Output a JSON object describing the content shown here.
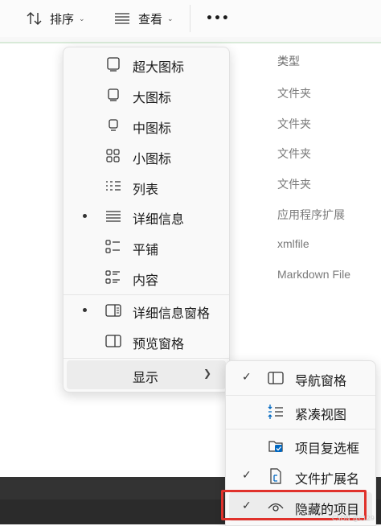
{
  "toolbar": {
    "sort_label": "排序",
    "view_label": "查看",
    "more_label": "•••"
  },
  "file_list": {
    "type_header": "类型",
    "types": [
      "文件夹",
      "文件夹",
      "文件夹",
      "文件夹",
      "应用程序扩展",
      "xmlfile",
      "Markdown File"
    ]
  },
  "view_menu": {
    "items": [
      {
        "label": "超大图标",
        "icon": "extra-large-icons-icon",
        "selected": false
      },
      {
        "label": "大图标",
        "icon": "large-icons-icon",
        "selected": false
      },
      {
        "label": "中图标",
        "icon": "medium-icons-icon",
        "selected": false
      },
      {
        "label": "小图标",
        "icon": "small-icons-icon",
        "selected": false
      },
      {
        "label": "列表",
        "icon": "list-icon",
        "selected": false
      },
      {
        "label": "详细信息",
        "icon": "details-icon",
        "selected": true
      },
      {
        "label": "平铺",
        "icon": "tiles-icon",
        "selected": false
      },
      {
        "label": "内容",
        "icon": "content-icon",
        "selected": false
      }
    ],
    "pane_items": [
      {
        "label": "详细信息窗格",
        "icon": "details-pane-icon",
        "selected": true
      },
      {
        "label": "预览窗格",
        "icon": "preview-pane-icon",
        "selected": false
      }
    ],
    "show_label": "显示"
  },
  "show_submenu": {
    "items": [
      {
        "label": "导航窗格",
        "icon": "navigation-pane-icon",
        "checked": true
      },
      {
        "label": "紧凑视图",
        "icon": "compact-view-icon",
        "checked": false
      },
      {
        "label": "项目复选框",
        "icon": "item-checkbox-icon",
        "checked": false
      },
      {
        "label": "文件扩展名",
        "icon": "file-extension-icon",
        "checked": true
      },
      {
        "label": "隐藏的项目",
        "icon": "hidden-items-icon",
        "checked": true
      }
    ]
  },
  "colors": {
    "highlight": "#e0312b",
    "accent": "#0067c0"
  },
  "watermark": "CSDN @c129"
}
